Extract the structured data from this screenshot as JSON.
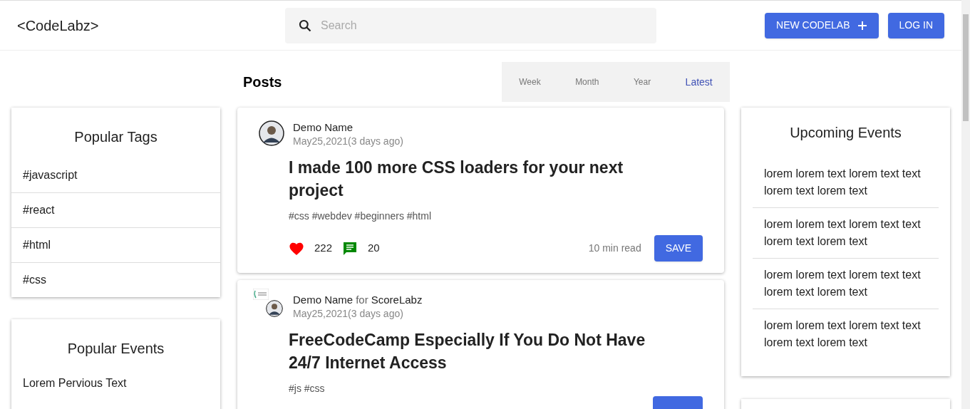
{
  "header": {
    "logo": "<CodeLabz>",
    "search": {
      "placeholder": "Search"
    },
    "buttons": [
      {
        "label": "NEW CODELAB",
        "kind": "add"
      },
      {
        "label": "LOG IN",
        "kind": "plain"
      }
    ]
  },
  "posts_header": {
    "title": "Posts",
    "tabs": [
      {
        "label": "Week",
        "selected": false
      },
      {
        "label": "Month",
        "selected": false
      },
      {
        "label": "Year",
        "selected": false
      },
      {
        "label": "Latest",
        "selected": true
      }
    ]
  },
  "popular_tags": {
    "title": "Popular Tags",
    "items": [
      "#javascript",
      "#react",
      "#html",
      "#css"
    ]
  },
  "popular_events": {
    "title": "Popular Events",
    "items": [
      "Lorem Pervious Text"
    ]
  },
  "posts": [
    {
      "kind": "full",
      "author": "Demo Name",
      "date": "May25,2021(3 days ago)",
      "title": "I made 100 more CSS loaders for your next project",
      "tags": "#css #webdev #beginners #html",
      "likes": "222",
      "comments": "20",
      "read_time": "10 min read",
      "save": "SAVE"
    },
    {
      "kind": "cut",
      "author": "Demo Name",
      "org_prefix": "for",
      "org": "ScoreLabz",
      "date": "May25,2021(3 days ago)",
      "title": "FreeCodeCamp Especially If You Do Not Have 24/7 Internet Access",
      "tags": "#js #css"
    }
  ],
  "upcoming_events": {
    "title": "Upcoming Events",
    "items": [
      "lorem lorem text lorem text text lorem text lorem text",
      "lorem lorem text lorem text text lorem text lorem text",
      "lorem lorem text lorem text text lorem text lorem text",
      "lorem lorem text lorem text text lorem text lorem text"
    ]
  }
}
